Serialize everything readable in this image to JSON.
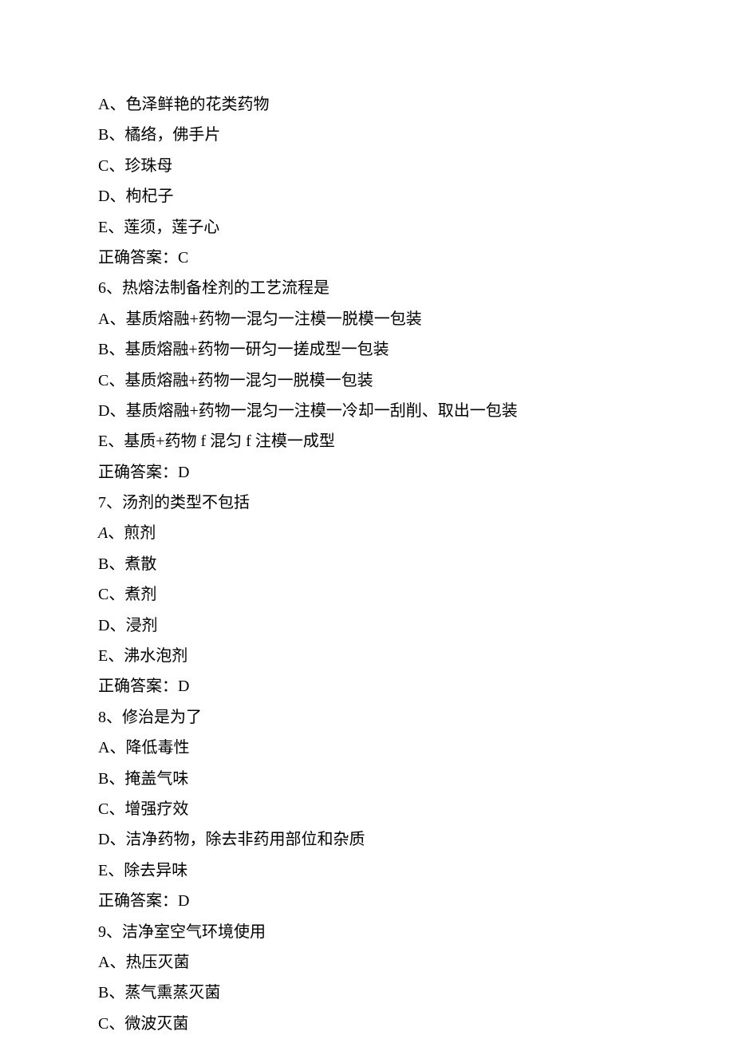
{
  "lines": [
    {
      "text": "A、色泽鲜艳的花类药物"
    },
    {
      "text": "B、橘络，佛手片"
    },
    {
      "text": "C、珍珠母"
    },
    {
      "text": "D、枸杞子"
    },
    {
      "text": "E、莲须，莲子心"
    },
    {
      "text": "正确答案：C"
    },
    {
      "text": "6、热熔法制备栓剂的工艺流程是"
    },
    {
      "text": "A、基质熔融+药物一混匀一注模一脱模一包装"
    },
    {
      "text": "B、基质熔融+药物一研匀一搓成型一包装"
    },
    {
      "text": "C、基质熔融+药物一混匀一脱模一包装"
    },
    {
      "text": "D、基质熔融+药物一混匀一注模一冷却一刮削、取出一包装"
    },
    {
      "text": "E、基质+药物 f 混匀 f 注模一成型"
    },
    {
      "text": "正确答案：D"
    },
    {
      "text": "7、汤剂的类型不包括"
    },
    {
      "text": "、煎剂",
      "prefix": "A",
      "prefixItalic": true
    },
    {
      "text": "B、煮散"
    },
    {
      "text": "C、煮剂"
    },
    {
      "text": "D、浸剂"
    },
    {
      "text": "E、沸水泡剂"
    },
    {
      "text": "正确答案：D"
    },
    {
      "text": "8、修治是为了"
    },
    {
      "text": "A、降低毒性"
    },
    {
      "text": "B、掩盖气味"
    },
    {
      "text": "C、增强疗效"
    },
    {
      "text": "D、洁净药物，除去非药用部位和杂质"
    },
    {
      "text": "E、除去异味"
    },
    {
      "text": "正确答案：D"
    },
    {
      "text": "9、洁净室空气环境使用"
    },
    {
      "text": "A、热压灭菌"
    },
    {
      "text": "B、蒸气熏蒸灭菌"
    },
    {
      "text": "C、微波灭菌"
    }
  ]
}
